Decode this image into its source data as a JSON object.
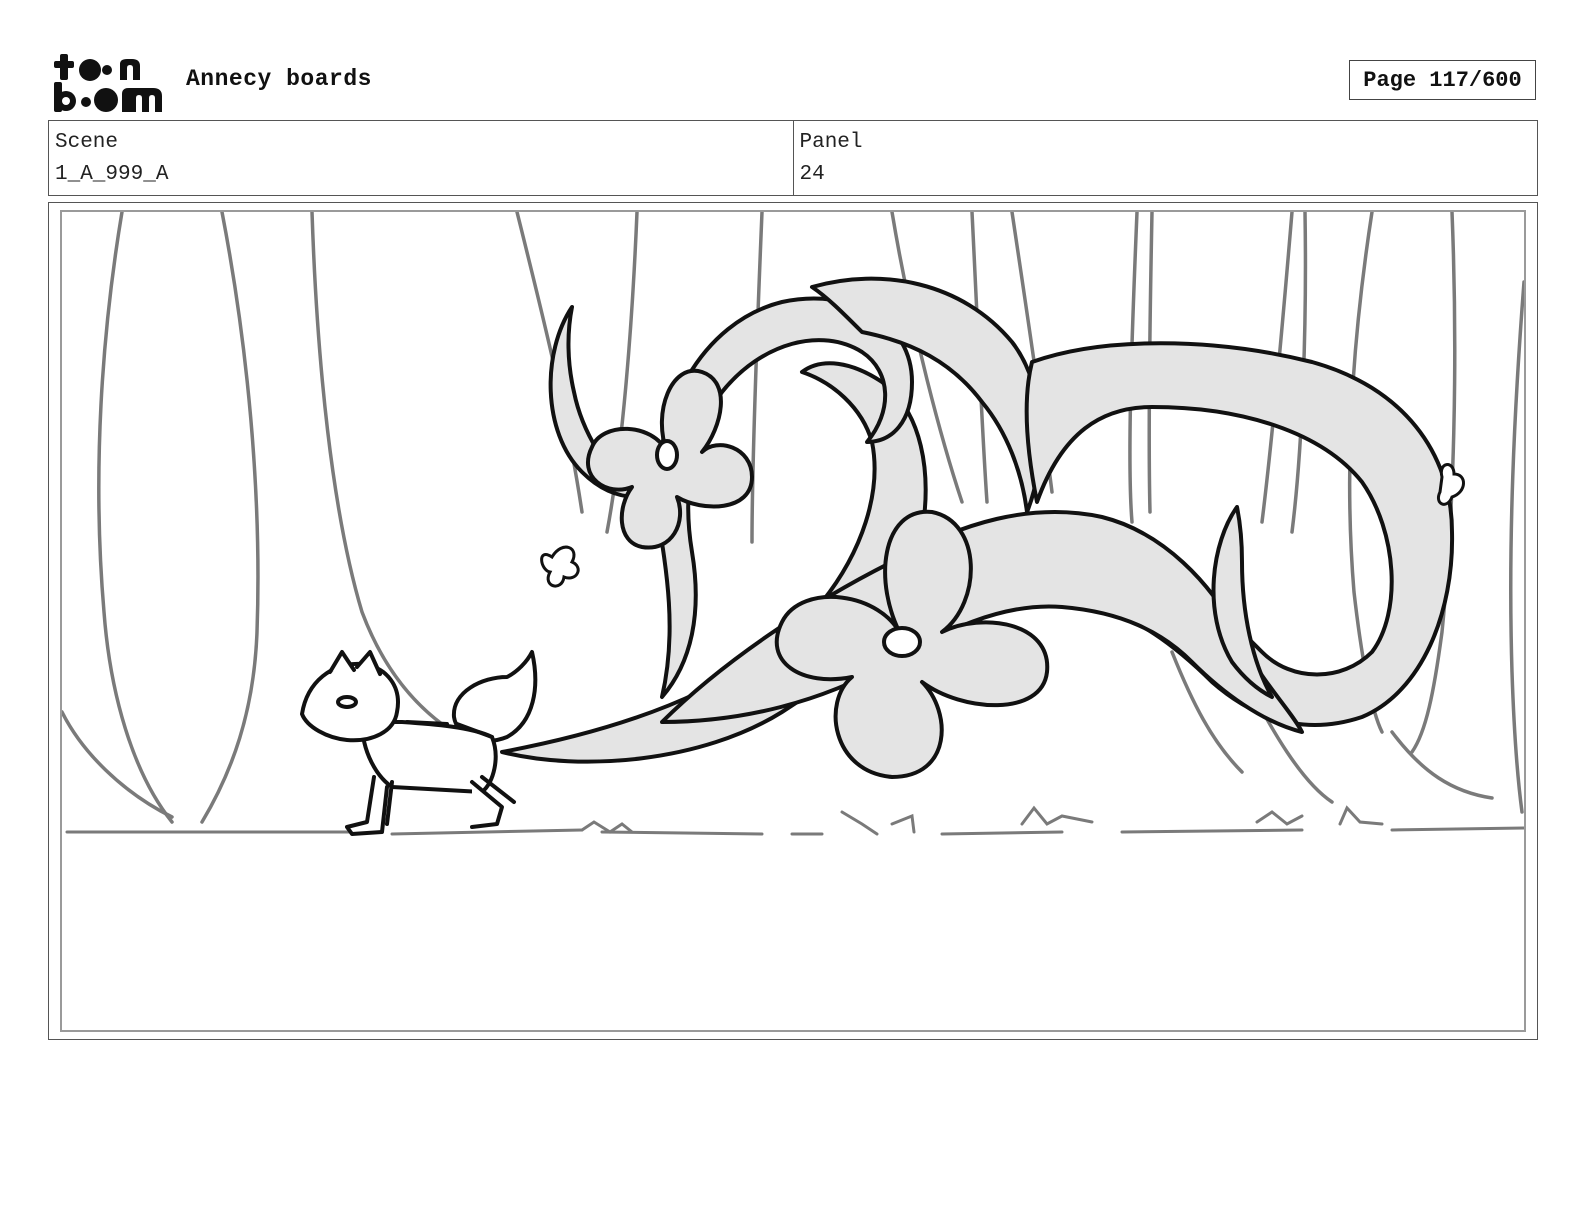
{
  "header": {
    "logo_text_top": "toon",
    "logo_text_bottom": "boom",
    "project_title": "Annecy boards",
    "page_indicator": "Page 117/600"
  },
  "info": {
    "scene_label": "Scene",
    "scene_value": "1_A_999_A",
    "panel_label": "Panel",
    "panel_value": "24"
  },
  "colors": {
    "ink": "#111111",
    "tree_gray": "#7a7a7a",
    "vine_fill": "#e4e4e4",
    "frame_border": "#555555"
  },
  "panel_icons": [
    "tree-trunk-icon",
    "vine-icon",
    "flower-icon",
    "fox-icon",
    "grass-icon"
  ]
}
